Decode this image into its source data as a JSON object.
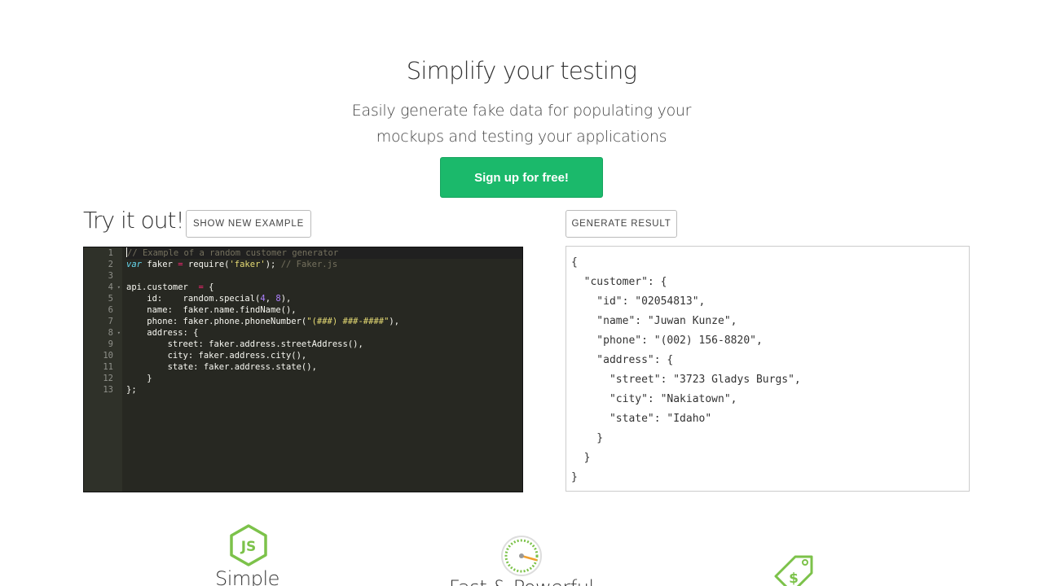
{
  "hero": {
    "title": "Simplify your testing",
    "subtitle_line1": "Easily generate fake data for populating your",
    "subtitle_line2": "mockups and testing your applications",
    "signup_label": "Sign up for free!"
  },
  "demo": {
    "title": "Try it out!",
    "show_example_label": "SHOW NEW EXAMPLE",
    "generate_label": "GENERATE RESULT"
  },
  "editor": {
    "line_numbers": [
      "1",
      "2",
      "3",
      "4",
      "5",
      "6",
      "7",
      "8",
      "9",
      "10",
      "11",
      "12",
      "13"
    ],
    "code": {
      "l1": "// Example of a random customer generator",
      "l2_kw": "var",
      "l2_a": " faker ",
      "l2_op": "=",
      "l2_b": " require(",
      "l2_str": "'faker'",
      "l2_c": "); ",
      "l2_cm": "// Faker.js",
      "l4_a": "api.customer  ",
      "l4_op": "=",
      "l4_b": " {",
      "l5_a": "    id:    random.special(",
      "l5_n1": "4",
      "l5_b": ", ",
      "l5_n2": "8",
      "l5_c": "),",
      "l6": "    name:  faker.name.findName(),",
      "l7_a": "    phone: faker.phone.phoneNumber(",
      "l7_str": "\"(###) ###-####\"",
      "l7_b": "),",
      "l8": "    address: {",
      "l9": "        street: faker.address.streetAddress(),",
      "l10": "        city: faker.address.city(),",
      "l11": "        state: faker.address.state(),",
      "l12": "    }",
      "l13": "};"
    }
  },
  "result": {
    "lines": [
      "{",
      "  \"customer\": {",
      "    \"id\": \"02054813\",",
      "    \"name\": \"Juwan Kunze\",",
      "    \"phone\": \"(002) 156-8820\",",
      "    \"address\": {",
      "      \"street\": \"3723 Gladys Burgs\",",
      "      \"city\": \"Nakiatown\",",
      "      \"state\": \"Idaho\"",
      "    }",
      "  }",
      "}"
    ]
  },
  "features": {
    "simple": {
      "label": "Simple",
      "icon": "nodejs-icon"
    },
    "fast": {
      "label": "Fast & Powerful",
      "icon": "speedometer-icon"
    },
    "price": {
      "icon": "price-tag-icon"
    }
  },
  "colors": {
    "accent": "#1bb96b",
    "editor_bg": "#272822",
    "icon_green": "#7cc24a"
  }
}
